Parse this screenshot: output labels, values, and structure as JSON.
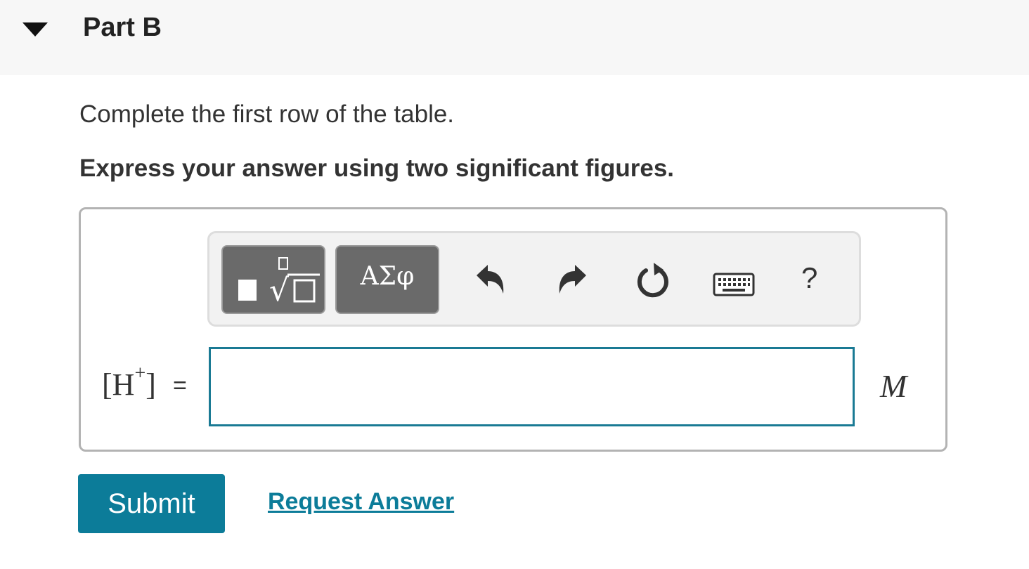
{
  "part": {
    "title": "Part B",
    "toggle_icon": "caret-down-icon"
  },
  "prompt": {
    "instruction": "Complete the first row of the table.",
    "emphasis": "Express your answer using two significant figures."
  },
  "toolbar": {
    "templates_icon": "math-templates-icon",
    "symbols_label": "ΑΣφ",
    "undo_icon": "undo-icon",
    "redo_icon": "redo-icon",
    "reset_icon": "reset-icon",
    "keyboard_icon": "keyboard-icon",
    "help_label": "?"
  },
  "answer": {
    "variable_base": "[H",
    "variable_sup": "+",
    "variable_close": "]",
    "equals": "=",
    "value": "",
    "unit": "M"
  },
  "actions": {
    "submit_label": "Submit",
    "request_label": "Request Answer"
  },
  "colors": {
    "accent": "#0c7c99",
    "input_border": "#1a7a94",
    "toolbar_button": "#6a6a6a",
    "header_bg": "#f7f7f7"
  }
}
